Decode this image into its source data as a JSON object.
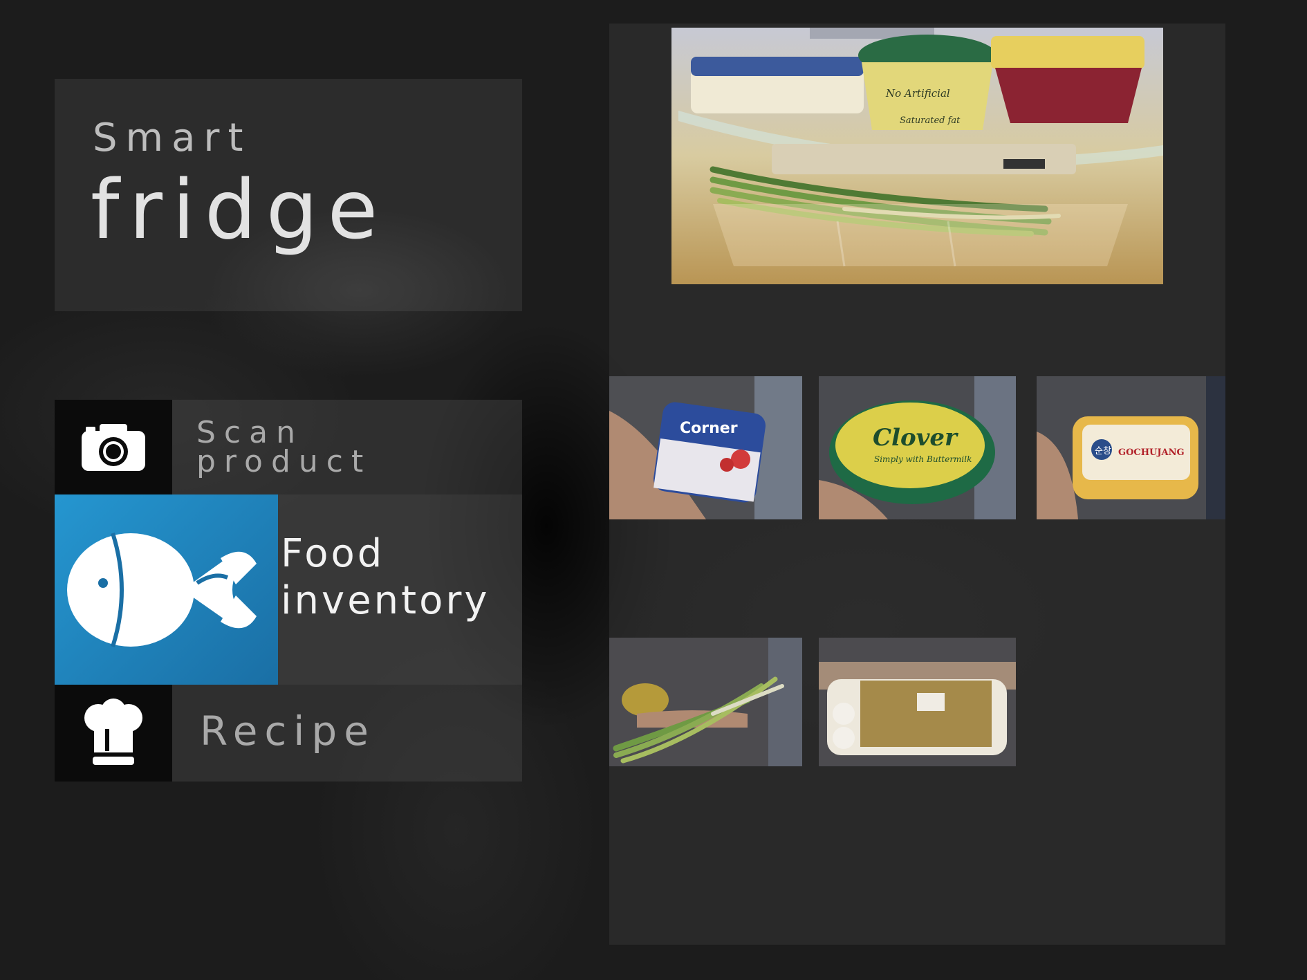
{
  "app": {
    "title_line1": "Smart",
    "title_line2": "fridge"
  },
  "menu": {
    "scan": {
      "line1": "Scan",
      "line2": "product",
      "icon": "camera-icon"
    },
    "food": {
      "line1": "Food",
      "line2": "inventory",
      "icon": "fish-icon",
      "selected": true
    },
    "recipe": {
      "label": "Recipe",
      "icon": "chef-hat-icon"
    }
  },
  "fridge_photo": {
    "label_left": "Absolutely No Artificial Ingredients",
    "label_right": "Half the Saturated fat of butter",
    "brand": "Clover"
  },
  "products": [
    {
      "brand": "Corner",
      "flavor": "Strawberry"
    },
    {
      "brand": "Clover",
      "tagline": "Simply with Buttermilk"
    },
    {
      "brand": "GOCHUJANG",
      "korean": "순창"
    },
    {
      "name": "spring onions"
    },
    {
      "name": "eggs"
    }
  ],
  "colors": {
    "accent": "#2596d0",
    "background": "#1c1c1c"
  }
}
